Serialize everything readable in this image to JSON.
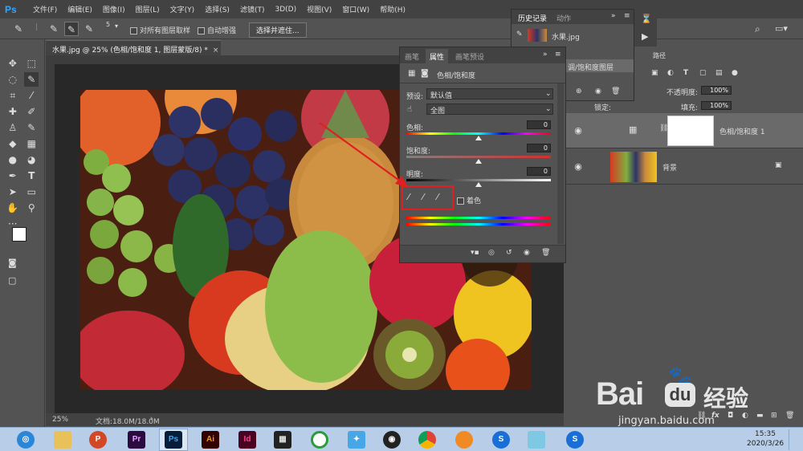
{
  "app": {
    "logo": "Ps",
    "accent": "#31a8ff"
  },
  "menubar": {
    "items": [
      "文件(F)",
      "编辑(E)",
      "图像(I)",
      "图层(L)",
      "文字(Y)",
      "选择(S)",
      "滤镜(T)",
      "3D(D)",
      "视图(V)",
      "窗口(W)",
      "帮助(H)"
    ]
  },
  "options": {
    "size_value": "5",
    "sample_all_layers": "对所有图层取样",
    "auto_enhance": "自动增强",
    "select_and_mask": "选择并遮住..."
  },
  "document": {
    "tab_title": "水果.jpg @ 25% (色相/饱和度 1, 图层蒙版/8) *",
    "close_glyph": "×",
    "zoom": "25%",
    "doc_size": "文档:18.0M/18.0M"
  },
  "history": {
    "tabs": [
      "历史记录",
      "动作"
    ],
    "snapshot_name": "水果.jpg",
    "last_state": "调/饱和度图层"
  },
  "properties": {
    "tabs": [
      "画笔",
      "属性",
      "画笔预设"
    ],
    "title": "色相/饱和度",
    "preset_label": "预设:",
    "preset_value": "默认值",
    "channel_value": "全图",
    "hue_label": "色相:",
    "hue_value": "0",
    "sat_label": "饱和度:",
    "sat_value": "0",
    "light_label": "明度:",
    "light_value": "0",
    "colorize_label": "着色"
  },
  "layers": {
    "path_tab": "路径",
    "opacity_label": "不透明度:",
    "opacity_value": "100%",
    "fill_label": "填充:",
    "fill_value": "100%",
    "lock_label": "锁定:",
    "items": [
      {
        "name": "色相/饱和度 1"
      },
      {
        "name": "背景"
      }
    ]
  },
  "taskbar": {
    "time": "15:35",
    "date": "2020/3/26",
    "apps": [
      {
        "label": "Pr",
        "bg": "#2a0a3f",
        "fg": "#e6a3ff"
      },
      {
        "label": "Ps",
        "bg": "#061e3a",
        "fg": "#31a8ff"
      },
      {
        "label": "Ai",
        "bg": "#330000",
        "fg": "#ff9a00"
      },
      {
        "label": "Id",
        "bg": "#49021f",
        "fg": "#ff3f94"
      }
    ]
  },
  "watermark": {
    "brand": "Bai",
    "brand2": "du",
    "cn": "经验",
    "url": "jingyan.baidu.com"
  }
}
